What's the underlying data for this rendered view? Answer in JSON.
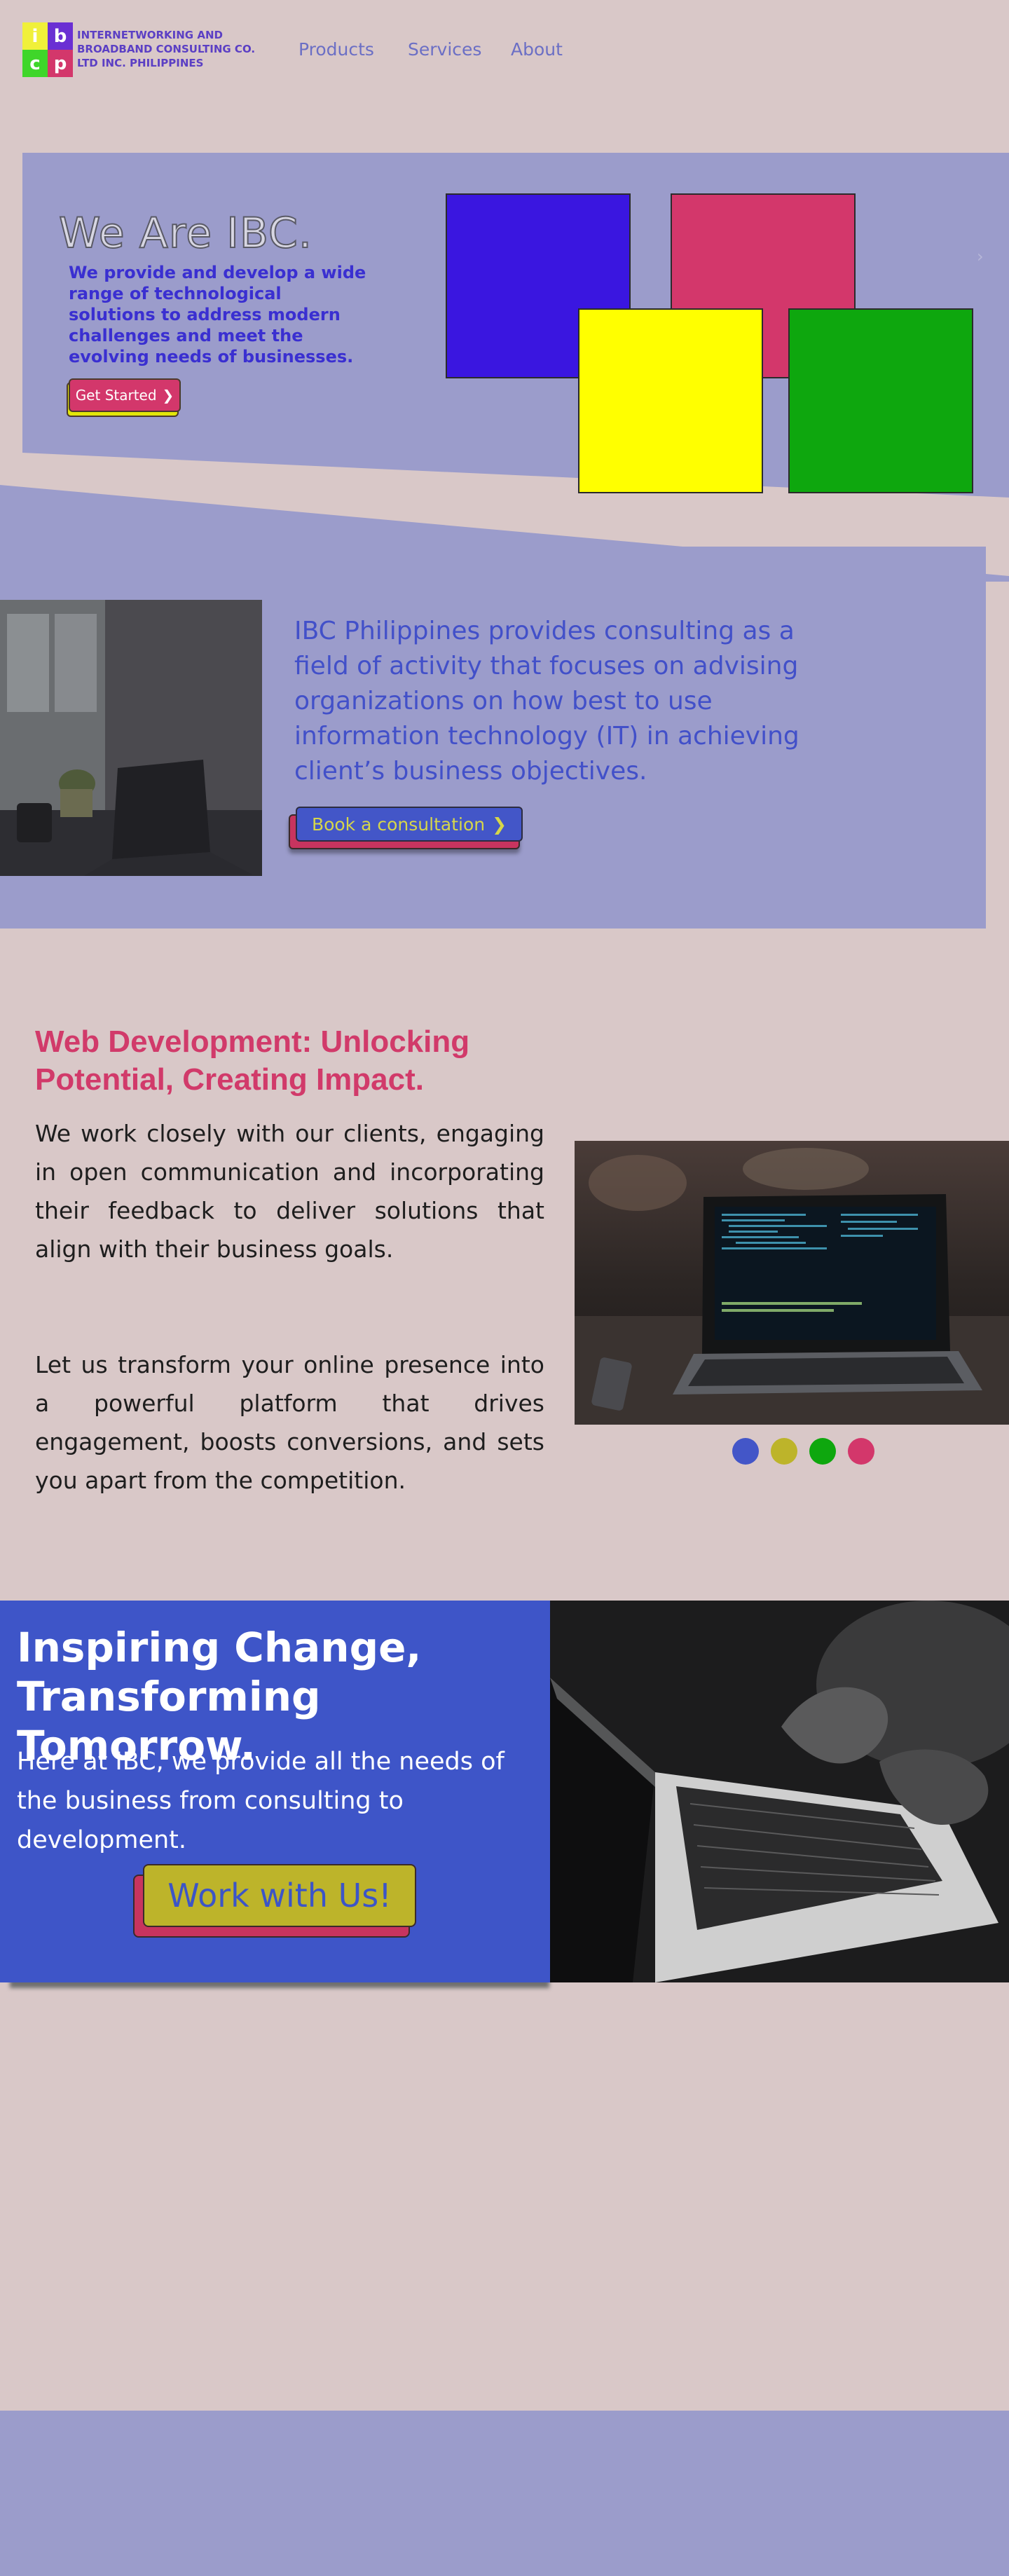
{
  "header": {
    "logo_letters": [
      "i",
      "b",
      "c",
      "p"
    ],
    "logo_colors": [
      "#f0f03a",
      "#6a2fd3",
      "#3fd62a",
      "#d3376b"
    ],
    "company_name_lines": [
      "INTERNETWORKING AND",
      "BROADBAND CONSULTING CO.",
      "LTD INC. PHILIPPINES"
    ],
    "nav": [
      "Products",
      "Services",
      "About"
    ]
  },
  "hero": {
    "title": "We Are IBC.",
    "description": "We provide and develop a wide range of technological solutions to address modern challenges and meet the evolving needs of businesses.",
    "cta_label": "Get Started",
    "cta_icon": "chevron-right-icon",
    "carousel_next_icon": "chevron-right-icon",
    "square_colors": [
      "#3a16e0",
      "#d3376b",
      "#ffff00",
      "#0ea70e"
    ]
  },
  "consulting": {
    "text": "IBC Philippines provides consulting as a field of activity that focuses on advising organizations on how best to use information technology (IT) in achieving client’s business objectives.",
    "cta_label": "Book a consultation",
    "cta_icon": "chevron-right-icon"
  },
  "web_dev": {
    "title": "Web Development: Unlocking Potential, Creating Impact.",
    "paragraph_1": "We work closely with our clients, engaging in open communication and incorporating their feedback to deliver solutions that align with their business goals.",
    "paragraph_2": "Let us transform your online presence into a powerful platform that drives engagement, boosts conversions, and sets you apart from the competition.",
    "carousel_dots": [
      "#4356c8",
      "#bdb42a",
      "#0ea70e",
      "#d3376b"
    ]
  },
  "cta": {
    "title": "Inspiring Change, Transforming Tomorrow.",
    "description": "Here at IBC, we provide all the needs of the business from consulting to development.",
    "button_label": "Work with Us!"
  },
  "colors": {
    "background": "#d9c8c8",
    "panel": "#9b9ccb",
    "blue": "#3e55c8",
    "pink": "#d3376b",
    "olive": "#bdb42a"
  }
}
